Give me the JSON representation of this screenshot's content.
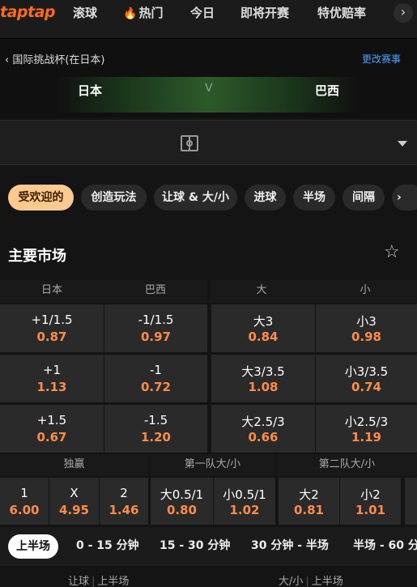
{
  "brand": {
    "logo": "taptap",
    "accent": "#ff6a1f"
  },
  "nav": {
    "items": [
      "滚球",
      "热门",
      "今日",
      "即将开赛",
      "特优赔率"
    ],
    "more_icon": "chevron-right-icon"
  },
  "match": {
    "competition": "国际挑战杯(在日本)",
    "change_label": "更改赛事",
    "home": "日本",
    "vs": "V",
    "away": "巴西"
  },
  "filters": [
    "受欢迎的",
    "创造玩法",
    "让球 & 大/小",
    "进球",
    "半场",
    "间隔"
  ],
  "section": {
    "title": "主要市场"
  },
  "main_market": {
    "headers": [
      "日本",
      "巴西",
      "大",
      "小"
    ],
    "rows": [
      {
        "h_line": "+1/1.5",
        "h_odd": "0.87",
        "a_line": "-1/1.5",
        "a_odd": "0.97",
        "o_line": "大3",
        "o_odd": "0.84",
        "u_line": "小3",
        "u_odd": "0.98"
      },
      {
        "h_line": "+1",
        "h_odd": "1.13",
        "a_line": "-1",
        "a_odd": "0.72",
        "o_line": "大3/3.5",
        "o_odd": "1.08",
        "u_line": "小3/3.5",
        "u_odd": "0.74"
      },
      {
        "h_line": "+1.5",
        "h_odd": "0.67",
        "a_line": "-1.5",
        "a_odd": "1.20",
        "o_line": "大2.5/3",
        "o_odd": "0.66",
        "u_line": "小2.5/3",
        "u_odd": "1.19"
      }
    ]
  },
  "sub_markets": {
    "headers": [
      "独赢",
      "第一队大/小",
      "第二队大/小"
    ],
    "win": [
      {
        "l": "1",
        "o": "6.00"
      },
      {
        "l": "X",
        "o": "4.95"
      },
      {
        "l": "2",
        "o": "1.46"
      }
    ],
    "team1": [
      {
        "l": "大0.5/1",
        "o": "0.80"
      },
      {
        "l": "小0.5/1",
        "o": "1.02"
      }
    ],
    "team2": [
      {
        "l": "大2",
        "o": "0.81"
      },
      {
        "l": "小2",
        "o": "1.01"
      }
    ]
  },
  "periods": [
    "上半场",
    "0 - 15 分钟",
    "15 - 30 分钟",
    "30 分钟 - 半场",
    "半场 - 60 分"
  ],
  "footer": {
    "left_a": "让球",
    "left_b": "上半场",
    "right_a": "大/小",
    "right_b": "上半场"
  }
}
